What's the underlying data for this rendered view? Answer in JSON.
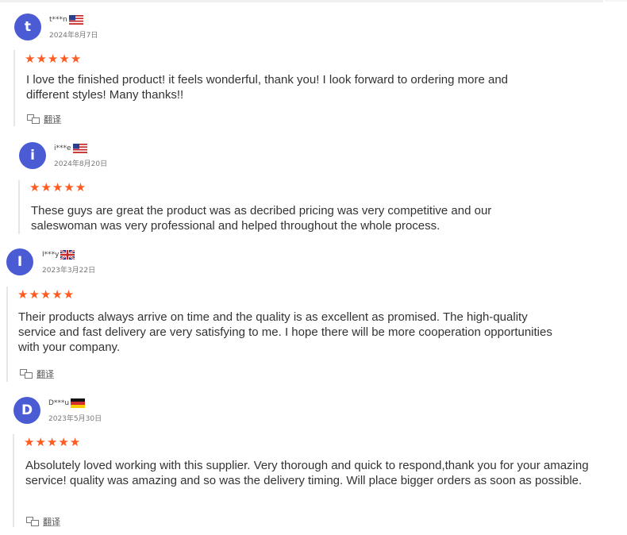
{
  "reviews": [
    {
      "avatar_letter": "t",
      "name": "t***n",
      "country_flag": "us-flag-icon",
      "date": "2024年8月7日",
      "stars": "★★★★★",
      "rating": 5,
      "text": "I love the finished product! it feels wonderful, thank you! I look forward to ordering more and different styles! Many thanks!!",
      "translate_label": "翻译",
      "show_translate": true
    },
    {
      "avatar_letter": "i",
      "name": "i***e",
      "country_flag": "us-flag-icon",
      "date": "2024年8月20日",
      "stars": "★★★★★",
      "rating": 5,
      "text": "These guys are great the product was as decribed pricing was very competitive and our saleswoman was very professional and helped throughout the whole process.",
      "translate_label": "",
      "show_translate": false
    },
    {
      "avatar_letter": "I",
      "name": "I***y",
      "country_flag": "uk-flag-icon",
      "date": "2023年3月22日",
      "stars": "★★★★★",
      "rating": 5,
      "text": "Their products always arrive on time and the quality is as excellent as promised. The high-quality service and fast delivery are very satisfying to me. I hope there will be more cooperation opportunities with your company.",
      "translate_label": "翻译",
      "show_translate": true
    },
    {
      "avatar_letter": "D",
      "name": "D***u",
      "country_flag": "de-flag-icon",
      "date": "2023年5月30日",
      "stars": "★★★★★",
      "rating": 5,
      "text": "Absolutely loved working with this supplier. Very thorough and quick to respond,thank you for your amazing service! quality was amazing and so was the delivery timing. Will place bigger orders as soon as possible.",
      "translate_label": "翻译",
      "show_translate": true
    }
  ],
  "colors": {
    "avatar": "#4a5bd4",
    "stars": "#ff5a1f",
    "text": "#333333",
    "divider": "#e6e6e6"
  }
}
